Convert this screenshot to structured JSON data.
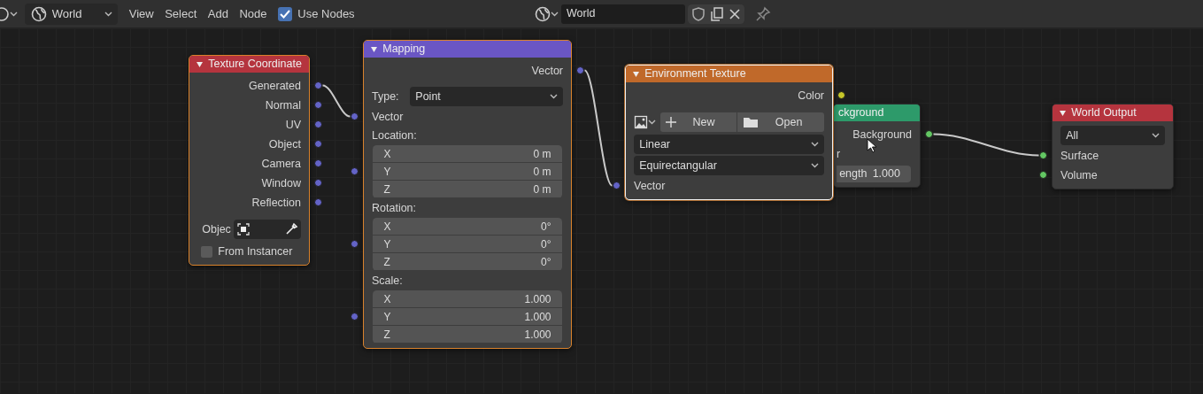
{
  "header": {
    "world_selector": {
      "value": "World"
    },
    "menus": [
      "View",
      "Select",
      "Add",
      "Node"
    ],
    "use_nodes": {
      "label": "Use Nodes",
      "checked": true
    },
    "world_field": {
      "value": "World"
    }
  },
  "nodes": [
    {
      "title": "Texture Coordinate",
      "color": "#b5343e",
      "arrow": true,
      "selected": true,
      "active": false,
      "rows": [
        {
          "kind": "output",
          "label": "Generated",
          "color": "#6363c7",
          "linked": true
        },
        {
          "kind": "output",
          "label": "Normal",
          "color": "#6363c7",
          "linked": false
        },
        {
          "kind": "output",
          "label": "UV",
          "color": "#6363c7",
          "linked": false
        },
        {
          "kind": "output",
          "label": "Object",
          "color": "#6363c7",
          "linked": false
        },
        {
          "kind": "output",
          "label": "Camera",
          "color": "#6363c7",
          "linked": false
        },
        {
          "kind": "output",
          "label": "Window",
          "color": "#6363c7",
          "linked": false
        },
        {
          "kind": "output",
          "label": "Reflection",
          "color": "#6363c7",
          "linked": false
        },
        {
          "kind": "object_field",
          "label": "Objec"
        },
        {
          "kind": "checkbox",
          "label": "From Instancer",
          "checked": false
        }
      ]
    },
    {
      "title": "Mapping",
      "color": "#6a56c4",
      "arrow": true,
      "selected": true,
      "active": false,
      "rows": [
        {
          "kind": "output",
          "label": "Vector",
          "color": "#6363c7",
          "linked": true
        },
        {
          "kind": "dropdown",
          "label": "Type:",
          "value": "Point"
        },
        {
          "kind": "input",
          "label": "Vector",
          "color": "#6363c7",
          "linked": true
        },
        {
          "kind": "label",
          "label": "Location:"
        },
        {
          "kind": "vector",
          "color": "#6363c7",
          "linked": false,
          "fields": [
            {
              "axis": "X",
              "value": "0 m"
            },
            {
              "axis": "Y",
              "value": "0 m"
            },
            {
              "axis": "Z",
              "value": "0 m"
            }
          ]
        },
        {
          "kind": "label",
          "label": "Rotation:"
        },
        {
          "kind": "vector",
          "color": "#6363c7",
          "linked": false,
          "fields": [
            {
              "axis": "X",
              "value": "0°"
            },
            {
              "axis": "Y",
              "value": "0°"
            },
            {
              "axis": "Z",
              "value": "0°"
            }
          ]
        },
        {
          "kind": "label",
          "label": "Scale:"
        },
        {
          "kind": "vector",
          "color": "#6363c7",
          "linked": false,
          "fields": [
            {
              "axis": "X",
              "value": "1.000"
            },
            {
              "axis": "Y",
              "value": "1.000"
            },
            {
              "axis": "Z",
              "value": "1.000"
            }
          ]
        }
      ]
    },
    {
      "title": "Environment Texture",
      "color": "#c0692a",
      "arrow": true,
      "selected": true,
      "active": true,
      "rows": [
        {
          "kind": "output",
          "label": "Color",
          "color": "#c7c729",
          "linked": false
        },
        {
          "kind": "image_buttons",
          "new_label": "New",
          "open_label": "Open"
        },
        {
          "kind": "dropdown",
          "value": "Linear"
        },
        {
          "kind": "dropdown",
          "value": "Equirectangular"
        },
        {
          "kind": "input",
          "label": "Vector",
          "color": "#6363c7",
          "linked": true
        }
      ]
    },
    {
      "title": "ckground",
      "color": "#2d9a6a",
      "arrow": false,
      "selected": false,
      "active": false,
      "rows": [
        {
          "kind": "output",
          "label": "Background",
          "color": "#63c763",
          "linked": true
        },
        {
          "kind": "input",
          "label": "r"
        },
        {
          "kind": "value_field",
          "label": "ength",
          "value": "1.000"
        }
      ]
    },
    {
      "title": "World Output",
      "color": "#b5343e",
      "arrow": true,
      "selected": false,
      "active": false,
      "rows": [
        {
          "kind": "dropdown",
          "value": "All"
        },
        {
          "kind": "input",
          "label": "Surface",
          "color": "#63c763",
          "linked": true
        },
        {
          "kind": "input",
          "label": "Volume",
          "color": "#63c763",
          "linked": false
        }
      ]
    }
  ]
}
